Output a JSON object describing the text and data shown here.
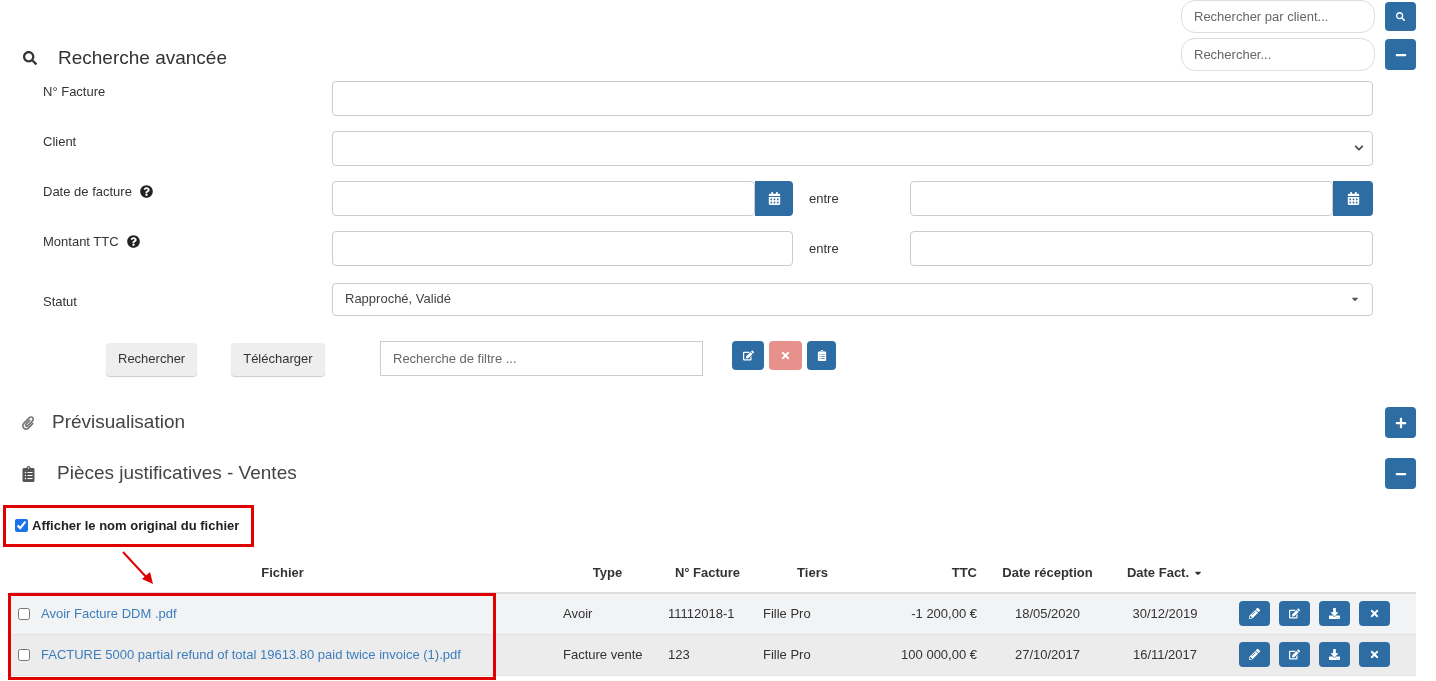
{
  "header_search": {
    "client_placeholder": "Rechercher par client...",
    "search_placeholder": "Rechercher..."
  },
  "advanced_search": {
    "title": "Recherche avancée",
    "expanded": true,
    "fields": [
      {
        "kind": "text",
        "label": "N° Facture",
        "help": false
      },
      {
        "kind": "select",
        "label": "Client",
        "help": false
      },
      {
        "kind": "date_range",
        "label": "Date de facture",
        "help": true,
        "between": "entre"
      },
      {
        "kind": "range",
        "label": "Montant TTC",
        "help": true,
        "between": "entre"
      },
      {
        "kind": "multiselect",
        "label": "Statut",
        "help": false,
        "value": "Rapproché, Validé"
      }
    ],
    "buttons": [
      "Rechercher",
      "Télécharger"
    ],
    "filter_placeholder": "Recherche de filtre ..."
  },
  "preview": {
    "title": "Prévisualisation",
    "expanded": false
  },
  "documents": {
    "title": "Pièces justificatives - Ventes",
    "expanded": true,
    "show_original_name": {
      "label": "Afficher le nom original du fichier",
      "checked": true
    },
    "columns": [
      {
        "label": "Fichier",
        "sorted": false
      },
      {
        "label": "Type",
        "sorted": false
      },
      {
        "label": "N° Facture",
        "sorted": false
      },
      {
        "label": "Tiers",
        "sorted": false
      },
      {
        "label": "TTC",
        "sorted": false
      },
      {
        "label": "Date réception",
        "sorted": false
      },
      {
        "label": "Date Fact.",
        "sorted": true
      }
    ],
    "rows": [
      {
        "checked": false,
        "file": "Avoir Facture DDM .pdf",
        "type": "Avoir",
        "invoice": "11112018-1",
        "party": "Fille Pro",
        "ttc": "-1 200,00 €",
        "received": "18/05/2020",
        "date": "30/12/2019"
      },
      {
        "checked": false,
        "file": "FACTURE 5000 partial refund of total 19613.80 paid twice invoice (1).pdf",
        "type": "Facture vente",
        "invoice": "123",
        "party": "Fille Pro",
        "ttc": "100 000,00 €",
        "received": "27/10/2017",
        "date": "16/11/2017"
      }
    ]
  }
}
